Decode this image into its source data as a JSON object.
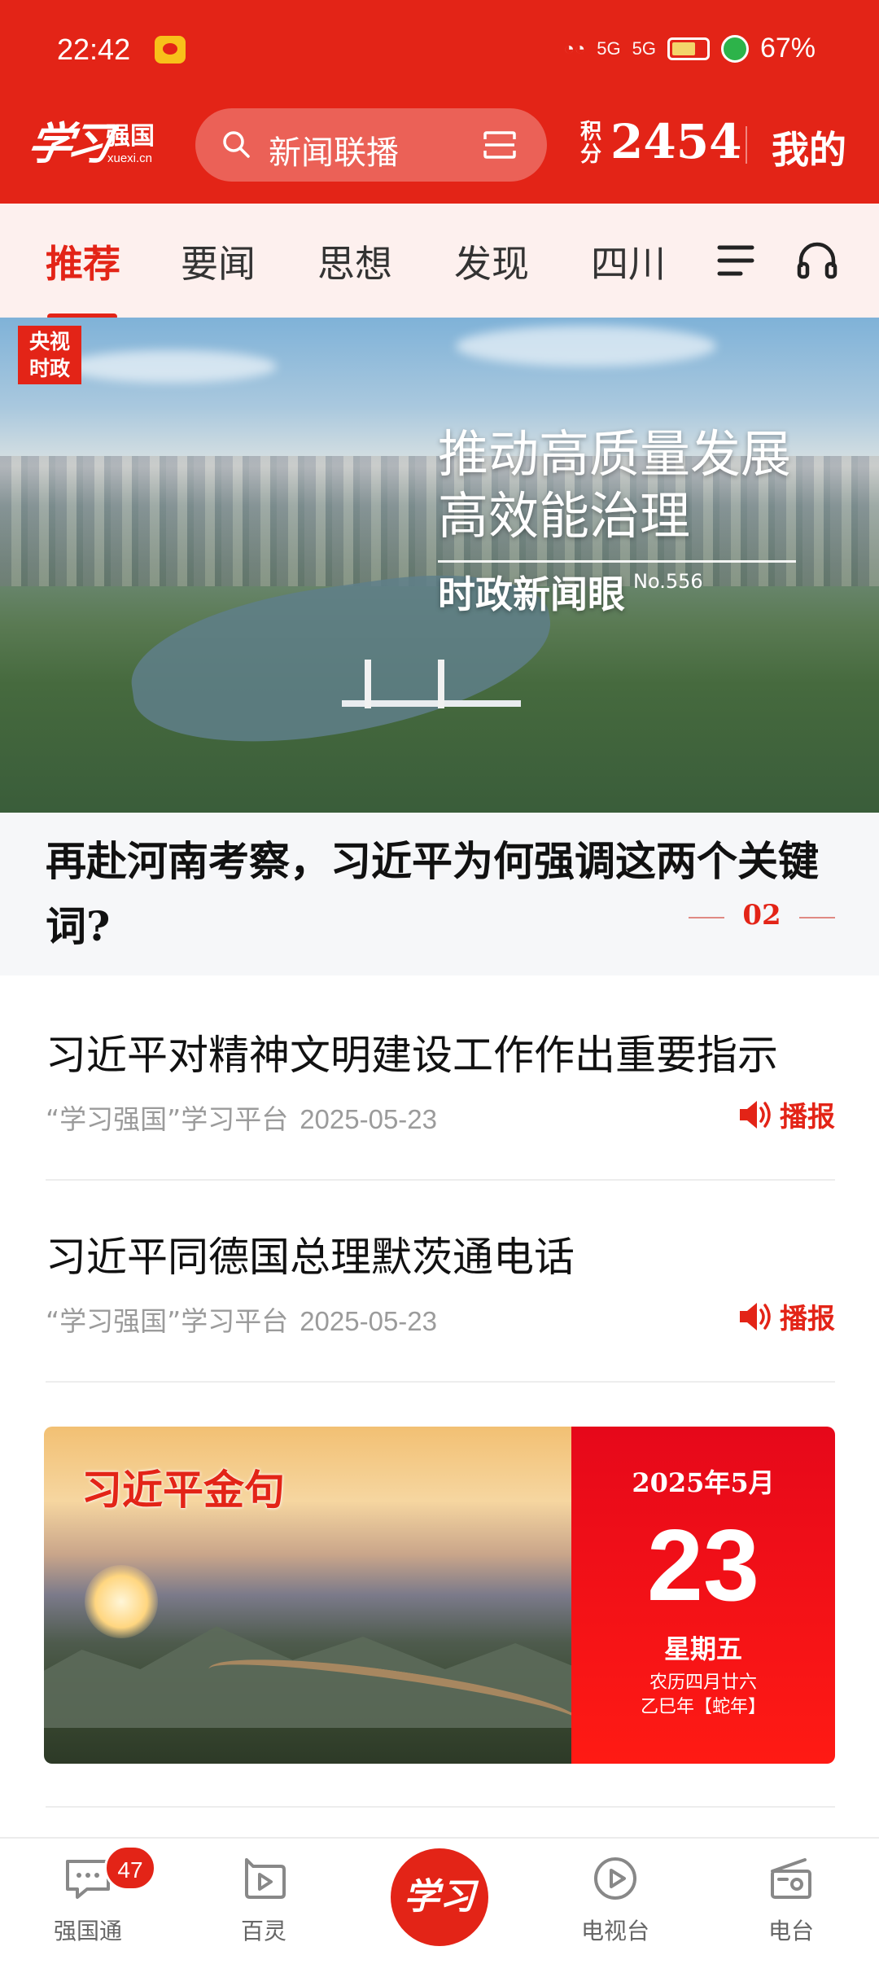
{
  "status_bar": {
    "time": "22:42",
    "network_labels": [
      "5G",
      "5G"
    ],
    "battery": "67%"
  },
  "header": {
    "logo_script": "学习",
    "logo_cn": "强国",
    "logo_en": "xuexi.cn",
    "search_placeholder": "新闻联播",
    "points_label": "积分",
    "points_value": "2454",
    "mine_label": "我的"
  },
  "tabs": [
    {
      "label": "推荐",
      "active": true
    },
    {
      "label": "要闻",
      "active": false
    },
    {
      "label": "思想",
      "active": false
    },
    {
      "label": "发现",
      "active": false
    },
    {
      "label": "四川",
      "active": false
    }
  ],
  "banner": {
    "badge_line1": "央视",
    "badge_line2": "时政",
    "headline_line1": "推动高质量发展",
    "headline_line2": "高效能治理",
    "subtitle": "时政新闻眼",
    "issue_no": "No.556",
    "caption": "再赴河南考察，习近平为何强调这两个关键词?",
    "page_indicator": "02"
  },
  "news": [
    {
      "title": "习近平对精神文明建设工作作出重要指示",
      "source": "“学习强国”学习平台",
      "date": "2025-05-23",
      "action_label": "播报"
    },
    {
      "title": "习近平同德国总理默茨通电话",
      "source": "“学习强国”学习平台",
      "date": "2025-05-23",
      "action_label": "播报"
    }
  ],
  "quote_card": {
    "title": "习近平金句",
    "year_month": "2025年5月",
    "day": "23",
    "weekday": "星期五",
    "lunar_line1": "农历四月廿六",
    "lunar_line2": "乙巳年【蛇年】"
  },
  "bottom_nav": {
    "items": [
      {
        "label": "强国通",
        "icon": "chat-icon"
      },
      {
        "label": "百灵",
        "icon": "video-play-icon"
      },
      {
        "label": "",
        "icon": "xuexi-center-icon"
      },
      {
        "label": "电视台",
        "icon": "tv-play-icon"
      },
      {
        "label": "电台",
        "icon": "radio-icon"
      }
    ],
    "badge_count": "47",
    "center_label": "学习"
  },
  "colors": {
    "brand_red": "#e32417",
    "tab_background": "#fdf0ee",
    "muted_text": "#9b9b9b"
  }
}
